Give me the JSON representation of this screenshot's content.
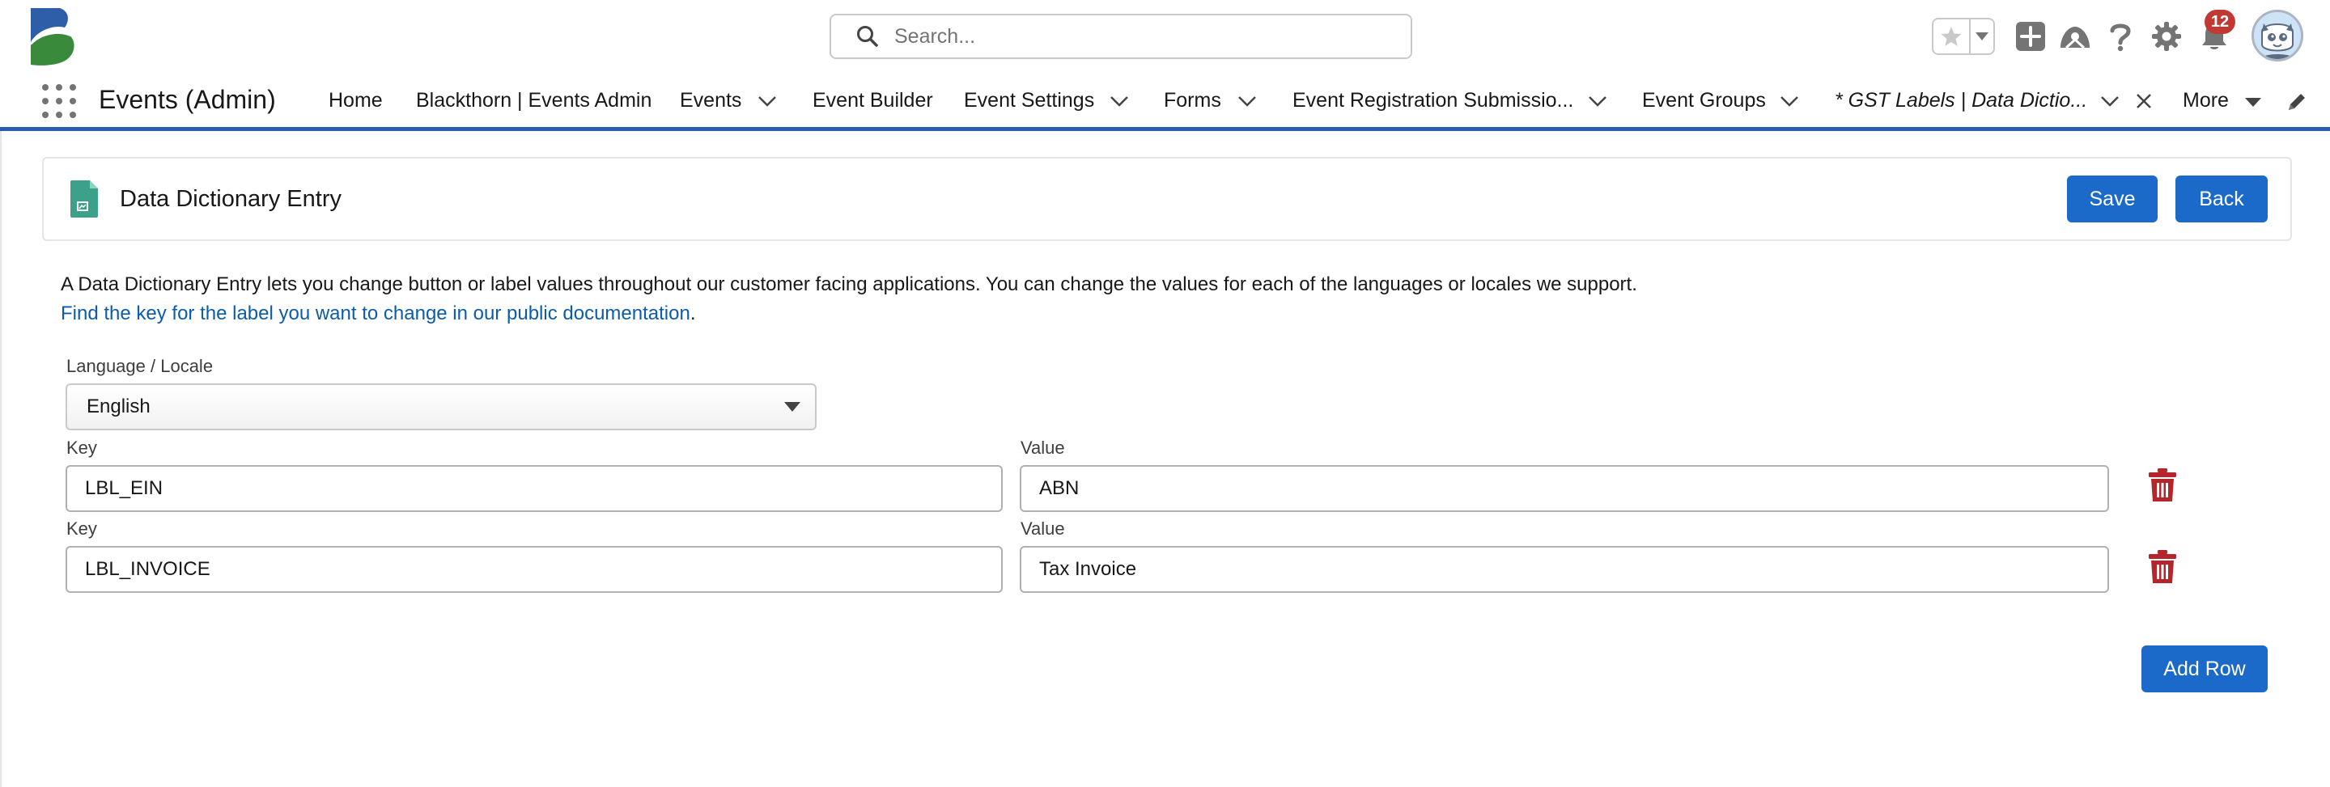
{
  "header": {
    "search_placeholder": "Search...",
    "notification_count": "12"
  },
  "nav": {
    "app_name": "Events (Admin)",
    "items": [
      {
        "label": "Home"
      },
      {
        "label": "Blackthorn | Events Admin"
      },
      {
        "label": "Events"
      },
      {
        "label": "Event Builder"
      },
      {
        "label": "Event Settings"
      },
      {
        "label": "Forms"
      },
      {
        "label": "Event Registration Submissio..."
      },
      {
        "label": "Event Groups"
      },
      {
        "label": "* GST Labels | Data Dictio..."
      },
      {
        "label": "More"
      }
    ]
  },
  "page": {
    "title": "Data Dictionary Entry",
    "save_label": "Save",
    "back_label": "Back",
    "description": "A Data Dictionary Entry lets you change button or label values throughout our customer facing applications. You can change the values for each of the languages or locales we support.",
    "doc_link": "Find the key for the label you want to change in our public documentation",
    "doc_link_suffix": ".",
    "locale_label": "Language / Locale",
    "locale_value": "English",
    "rows": [
      {
        "key_label": "Key",
        "key": "LBL_EIN",
        "value_label": "Value",
        "value": "ABN"
      },
      {
        "key_label": "Key",
        "key": "LBL_INVOICE",
        "value_label": "Value",
        "value": "Tax Invoice"
      }
    ],
    "add_row_label": "Add Row"
  },
  "colors": {
    "brand_button": "#1b6ac9",
    "nav_underline": "#2a5db0",
    "link": "#0b5cab",
    "delete_icon": "#b4262b",
    "badge": "#c23934"
  }
}
